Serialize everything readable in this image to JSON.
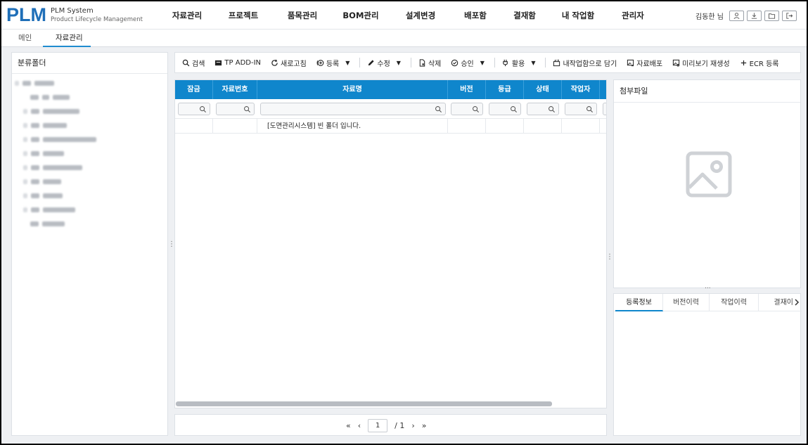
{
  "header": {
    "logo_mark": "PLM",
    "logo_title": "PLM System",
    "logo_subtitle": "Product Lifecycle Management",
    "menu": [
      "자료관리",
      "프로젝트",
      "품목관리",
      "BOM관리",
      "설계변경",
      "배포함",
      "결재함",
      "내 작업함",
      "관리자"
    ],
    "user_name": "김동한 님"
  },
  "tabs": {
    "main": "메인",
    "active": "자료관리",
    "close": "×"
  },
  "left_panel": {
    "title": "분류폴더"
  },
  "toolbar": {
    "search": "검색",
    "tp_addin": "TP ADD-IN",
    "refresh": "새로고침",
    "register": "등록",
    "edit": "수정",
    "delete": "삭제",
    "approve": "승인",
    "use": "활용",
    "to_workbox": "내작업함으로 담기",
    "distribute": "자료배포",
    "regen_preview": "미리보기 재생성",
    "ecr_register": "ECR 등록"
  },
  "grid": {
    "columns": [
      "잠금",
      "자료번호",
      "자료명",
      "버전",
      "등급",
      "상태",
      "작업자"
    ],
    "empty_message": "[도면관리시스템] 빈 폴더 입니다."
  },
  "pager": {
    "first": "«",
    "prev": "‹",
    "current": "1",
    "total": "/ 1",
    "next": "›",
    "last": "»"
  },
  "attachment": {
    "title": "첨부파일",
    "divider": "..."
  },
  "info_tabs": [
    "등록정보",
    "버전이력",
    "작업이력",
    "결재이"
  ],
  "colors": {
    "brand": "#1f6fb8",
    "grid_header": "#0f86cc",
    "tab_underline": "#1f8ccf"
  }
}
